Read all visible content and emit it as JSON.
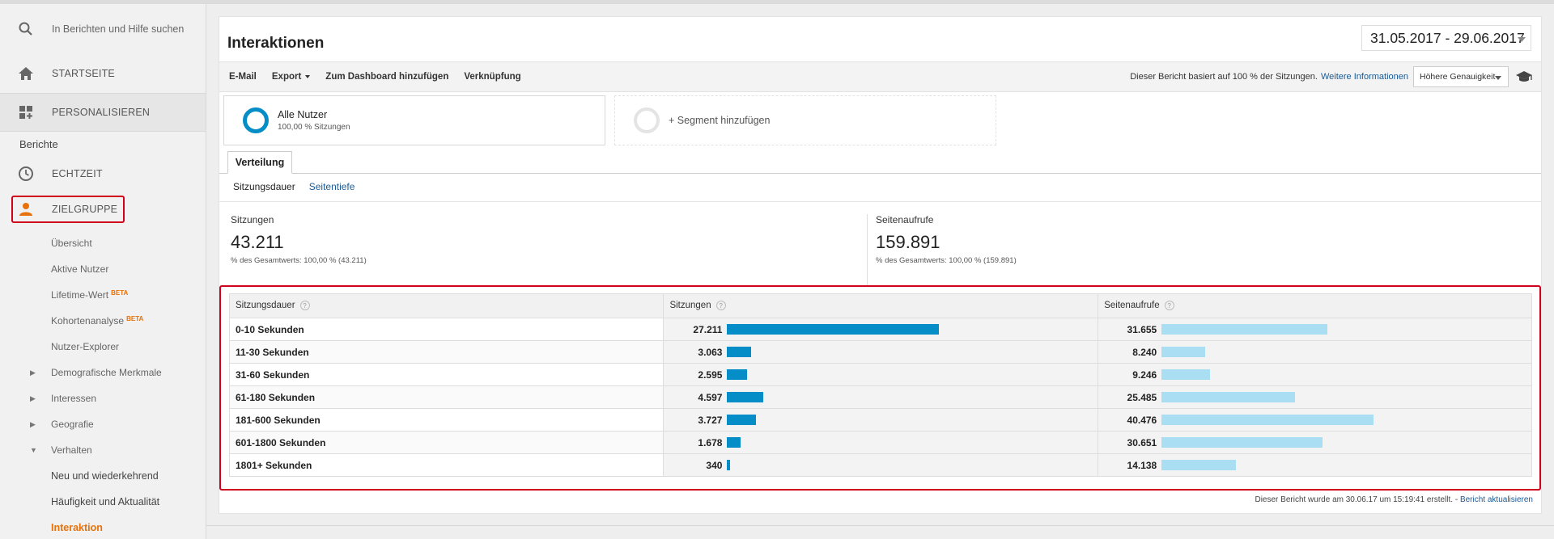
{
  "sidebar": {
    "search_placeholder": "In Berichten und Hilfe suchen",
    "nav": [
      {
        "label": "STARTSEITE",
        "icon": "home-icon"
      },
      {
        "label": "PERSONALISIEREN",
        "icon": "dashboard-icon"
      }
    ],
    "reports_heading": "Berichte",
    "realtime": {
      "label": "ECHTZEIT",
      "icon": "clock-icon"
    },
    "audience": {
      "label": "ZIELGRUPPE",
      "icon": "person-icon"
    },
    "sub_items": [
      {
        "label": "Übersicht"
      },
      {
        "label": "Aktive Nutzer"
      },
      {
        "label": "Lifetime-Wert",
        "badge": "BETA"
      },
      {
        "label": "Kohortenanalyse",
        "badge": "BETA"
      },
      {
        "label": "Nutzer-Explorer"
      },
      {
        "label": "Demografische Merkmale"
      },
      {
        "label": "Interessen"
      },
      {
        "label": "Geografie"
      },
      {
        "label": "Verhalten"
      },
      {
        "label": "Neu und wiederkehrend"
      },
      {
        "label": "Häufigkeit und Aktualität"
      },
      {
        "label": "Interaktion"
      }
    ],
    "accent_color": "#e8710a"
  },
  "header": {
    "title": "Interaktionen",
    "date_range": "31.05.2017 - 29.06.2017"
  },
  "toolbar": {
    "email": "E-Mail",
    "export": "Export",
    "dashboard": "Zum Dashboard hinzufügen",
    "shortcut": "Verknüpfung",
    "sampling_text": "Dieser Bericht basiert auf 100 % der Sitzungen.",
    "more_info": "Weitere Informationen",
    "precision": "Höhere Genauigkeit"
  },
  "segments": {
    "active": {
      "title": "Alle Nutzer",
      "subtitle": "100,00 % Sitzungen"
    },
    "add": "+ Segment hinzufügen"
  },
  "tabs": {
    "main": "Verteilung",
    "sub": [
      "Sitzungsdauer",
      "Seitentiefe"
    ]
  },
  "summary": [
    {
      "label": "Sitzungen",
      "value": "43.211",
      "pct": "% des Gesamtwerts: 100,00 % (43.211)"
    },
    {
      "label": "Seitenaufrufe",
      "value": "159.891",
      "pct": "% des Gesamtwerts: 100,00 % (159.891)"
    }
  ],
  "table": {
    "headers": [
      "Sitzungsdauer",
      "Sitzungen",
      "Seitenaufrufe"
    ],
    "help_glyph": "?",
    "rows": [
      {
        "label": "0-10 Sekunden",
        "sessions": "27.211",
        "sessions_n": 27211,
        "views": "31.655",
        "views_n": 31655
      },
      {
        "label": "11-30 Sekunden",
        "sessions": "3.063",
        "sessions_n": 3063,
        "views": "8.240",
        "views_n": 8240
      },
      {
        "label": "31-60 Sekunden",
        "sessions": "2.595",
        "sessions_n": 2595,
        "views": "9.246",
        "views_n": 9246
      },
      {
        "label": "61-180 Sekunden",
        "sessions": "4.597",
        "sessions_n": 4597,
        "views": "25.485",
        "views_n": 25485
      },
      {
        "label": "181-600 Sekunden",
        "sessions": "3.727",
        "sessions_n": 3727,
        "views": "40.476",
        "views_n": 40476
      },
      {
        "label": "601-1800 Sekunden",
        "sessions": "1.678",
        "sessions_n": 1678,
        "views": "30.651",
        "views_n": 30651
      },
      {
        "label": "1801+ Sekunden",
        "sessions": "340",
        "sessions_n": 340,
        "views": "14.138",
        "views_n": 14138
      }
    ],
    "bar_colors": {
      "sessions": "#058dc7",
      "views": "#aadff3"
    }
  },
  "footer": {
    "text": "Dieser Bericht wurde am 30.06.17 um 15:19:41 erstellt. -",
    "link": "Bericht aktualisieren"
  }
}
